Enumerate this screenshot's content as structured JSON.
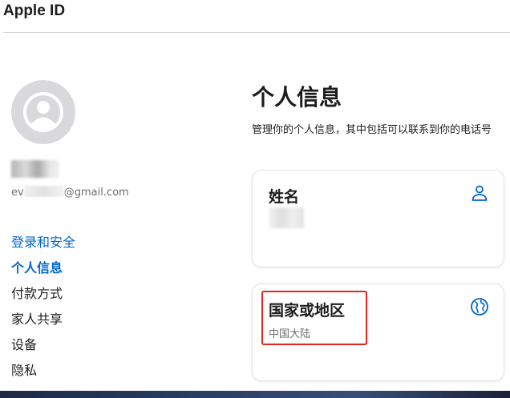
{
  "header": {
    "title": "Apple ID"
  },
  "account": {
    "email_prefix": "ev",
    "email_suffix": "@gmail.com"
  },
  "sidebar": {
    "items": [
      {
        "label": "登录和安全",
        "state": "link"
      },
      {
        "label": "个人信息",
        "state": "active"
      },
      {
        "label": "付款方式",
        "state": "normal"
      },
      {
        "label": "家人共享",
        "state": "normal"
      },
      {
        "label": "设备",
        "state": "normal"
      },
      {
        "label": "隐私",
        "state": "normal"
      }
    ]
  },
  "main": {
    "title": "个人信息",
    "description": "管理你的个人信息，其中包括可以联系到你的电话号",
    "cards": [
      {
        "title": "姓名",
        "value": "",
        "icon": "person-icon"
      },
      {
        "title": "国家或地区",
        "value": "中国大陆",
        "icon": "globe-icon"
      }
    ]
  },
  "colors": {
    "accent": "#0066cc",
    "highlight": "#e0251b",
    "text": "#1d1d1f",
    "secondary_text": "#6e6e73"
  }
}
